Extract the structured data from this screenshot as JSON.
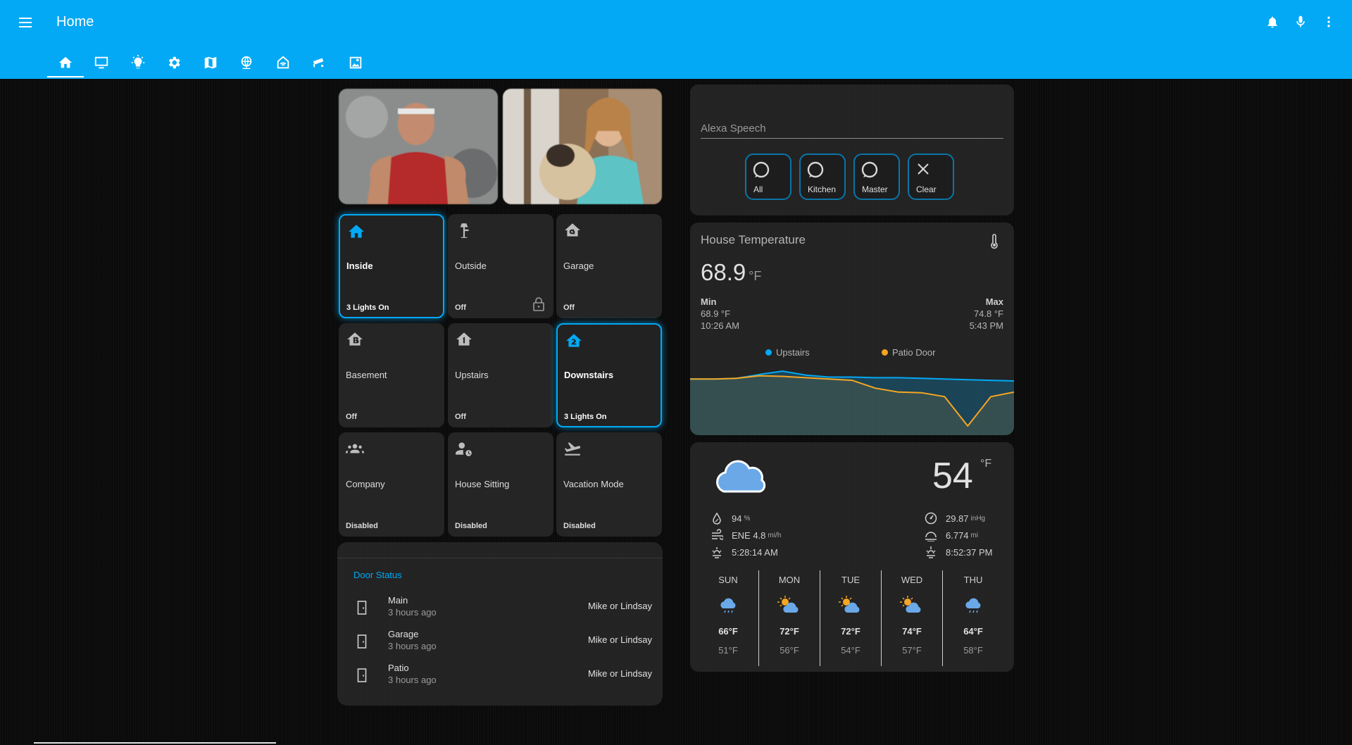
{
  "app": {
    "title": "Home"
  },
  "header_icons": [
    "bell-icon",
    "microphone-icon",
    "more-vertical-icon"
  ],
  "tabs": [
    "home-icon",
    "monitor-icon",
    "lightbulb-icon",
    "gear-icon",
    "map-icon",
    "globe-icon",
    "home-automation-icon",
    "cctv-icon",
    "image-icon"
  ],
  "tiles": [
    {
      "name": "Inside",
      "state": "3 Lights On",
      "icon": "home-icon",
      "on": true
    },
    {
      "name": "Outside",
      "state": "Off",
      "icon": "outdoor-lamp-icon",
      "on": false
    },
    {
      "name": "Garage",
      "state": "Off",
      "icon": "garage-icon",
      "on": false
    },
    {
      "name": "Basement",
      "state": "Off",
      "icon": "home-floor-b-icon",
      "on": false
    },
    {
      "name": "Upstairs",
      "state": "Off",
      "icon": "home-floor-1-icon",
      "on": false
    },
    {
      "name": "Downstairs",
      "state": "3 Lights On",
      "icon": "home-floor-2-icon",
      "on": true
    },
    {
      "name": "Company",
      "state": "Disabled",
      "icon": "account-group-icon",
      "on": false
    },
    {
      "name": "House Sitting",
      "state": "Disabled",
      "icon": "account-clock-icon",
      "on": false
    },
    {
      "name": "Vacation Mode",
      "state": "Disabled",
      "icon": "airplane-takeoff-icon",
      "on": false
    }
  ],
  "door_status": {
    "title": "Door Status",
    "rows": [
      {
        "name": "Main",
        "time": "3 hours ago",
        "value": "Mike or Lindsay"
      },
      {
        "name": "Garage",
        "time": "3 hours ago",
        "value": "Mike or Lindsay"
      },
      {
        "name": "Patio",
        "time": "3 hours ago",
        "value": "Mike or Lindsay"
      }
    ]
  },
  "alexa": {
    "label": "Alexa Speech",
    "buttons": [
      {
        "label": "All",
        "icon": "alexa-ring-icon"
      },
      {
        "label": "Kitchen",
        "icon": "alexa-ring-icon"
      },
      {
        "label": "Master",
        "icon": "alexa-ring-icon"
      },
      {
        "label": "Clear",
        "icon": "close-icon"
      }
    ]
  },
  "temperature": {
    "title": "House Temperature",
    "value": "68.9",
    "unit": "°F",
    "min_label": "Min",
    "min_value": "68.9 °F",
    "min_time": "10:26 AM",
    "max_label": "Max",
    "max_value": "74.8 °F",
    "max_time": "5:43 PM",
    "legend": [
      "Upstairs",
      "Patio Door"
    ],
    "colors": {
      "upstairs": "#03a9f4",
      "patio": "#f5a623"
    }
  },
  "chart_data": {
    "type": "line",
    "series": [
      {
        "name": "Upstairs",
        "values": [
          69.6,
          69.6,
          69.7,
          70.3,
          70.8,
          70.2,
          69.9,
          69.9,
          69.8,
          69.8,
          69.7,
          69.6,
          69.5,
          69.4,
          69.3
        ]
      },
      {
        "name": "Patio Door",
        "values": [
          69.6,
          69.6,
          69.7,
          70.1,
          70.0,
          69.8,
          69.6,
          69.4,
          68.2,
          67.6,
          67.5,
          66.9,
          62.4,
          66.9,
          67.6
        ]
      }
    ]
  },
  "weather": {
    "temp": "54",
    "unit": "°F",
    "current_icon": "cloudy-icon",
    "left": [
      {
        "icon": "humidity-icon",
        "value": "94",
        "unit": "%"
      },
      {
        "icon": "wind-icon",
        "value": "ENE 4.8",
        "unit": "mi/h"
      },
      {
        "icon": "sunrise-icon",
        "value": "5:28:14 AM",
        "unit": ""
      }
    ],
    "right": [
      {
        "icon": "gauge-icon",
        "value": "29.87",
        "unit": "inHg"
      },
      {
        "icon": "visibility-icon",
        "value": "6.774",
        "unit": "mi"
      },
      {
        "icon": "sunset-icon",
        "value": "8:52:37 PM",
        "unit": ""
      }
    ],
    "forecast": [
      {
        "day": "SUN",
        "high": "66°F",
        "low": "51°F",
        "icon": "rainy-icon"
      },
      {
        "day": "MON",
        "high": "72°F",
        "low": "56°F",
        "icon": "partly-cloudy-icon"
      },
      {
        "day": "TUE",
        "high": "72°F",
        "low": "54°F",
        "icon": "partly-cloudy-icon"
      },
      {
        "day": "WED",
        "high": "74°F",
        "low": "57°F",
        "icon": "partly-cloudy-icon"
      },
      {
        "day": "THU",
        "high": "64°F",
        "low": "58°F",
        "icon": "rainy-icon"
      }
    ]
  }
}
